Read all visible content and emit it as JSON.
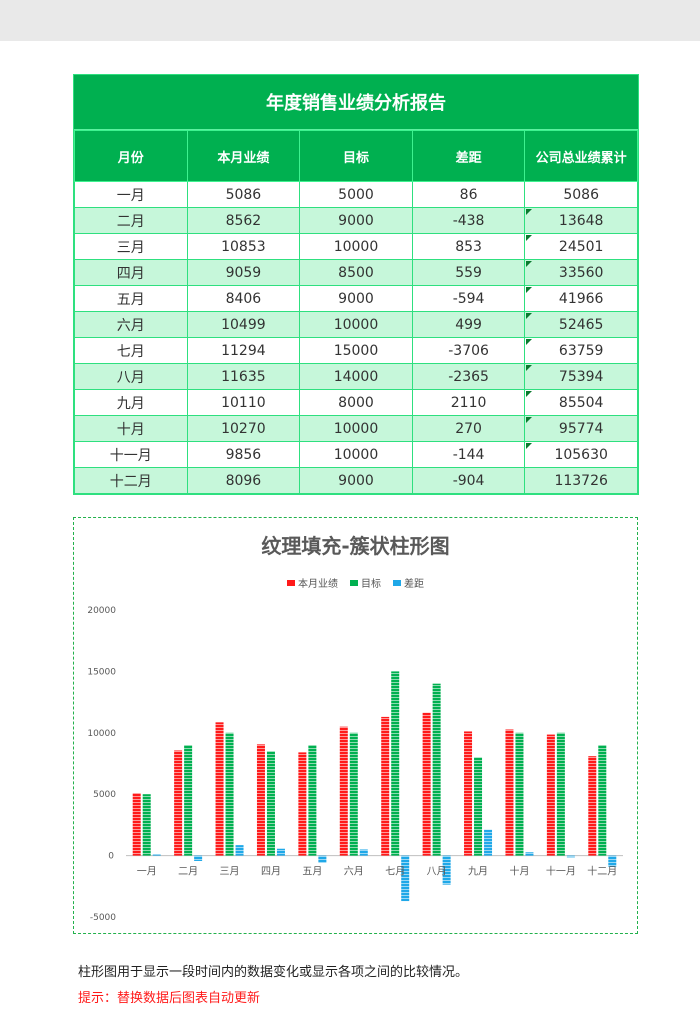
{
  "report": {
    "title": "年度销售业绩分析报告",
    "columns": [
      "月份",
      "本月业绩",
      "目标",
      "差距",
      "公司总业绩累计"
    ],
    "rows": [
      [
        "一月",
        "5086",
        "5000",
        "86",
        "5086"
      ],
      [
        "二月",
        "8562",
        "9000",
        "-438",
        "13648"
      ],
      [
        "三月",
        "10853",
        "10000",
        "853",
        "24501"
      ],
      [
        "四月",
        "9059",
        "8500",
        "559",
        "33560"
      ],
      [
        "五月",
        "8406",
        "9000",
        "-594",
        "41966"
      ],
      [
        "六月",
        "10499",
        "10000",
        "499",
        "52465"
      ],
      [
        "七月",
        "11294",
        "15000",
        "-3706",
        "63759"
      ],
      [
        "八月",
        "11635",
        "14000",
        "-2365",
        "75394"
      ],
      [
        "九月",
        "10110",
        "8000",
        "2110",
        "85504"
      ],
      [
        "十月",
        "10270",
        "10000",
        "270",
        "95774"
      ],
      [
        "十一月",
        "9856",
        "10000",
        "-144",
        "105630"
      ],
      [
        "十二月",
        "8096",
        "9000",
        "-904",
        "113726"
      ]
    ]
  },
  "chart_data": {
    "type": "bar",
    "title": "纹理填充-簇状柱形图",
    "xlabel": "",
    "ylabel": "",
    "categories": [
      "一月",
      "二月",
      "三月",
      "四月",
      "五月",
      "六月",
      "七月",
      "八月",
      "九月",
      "十月",
      "十一月",
      "十二月"
    ],
    "series": [
      {
        "name": "本月业绩",
        "color": "#ff1a1a",
        "values": [
          5086,
          8562,
          10853,
          9059,
          8406,
          10499,
          11294,
          11635,
          10110,
          10270,
          9856,
          8096
        ]
      },
      {
        "name": "目标",
        "color": "#00b050",
        "values": [
          5000,
          9000,
          10000,
          8500,
          9000,
          10000,
          15000,
          14000,
          8000,
          10000,
          10000,
          9000
        ]
      },
      {
        "name": "差距",
        "color": "#1fa8e8",
        "values": [
          86,
          -438,
          853,
          559,
          -594,
          499,
          -3706,
          -2365,
          2110,
          270,
          -144,
          -904
        ]
      }
    ],
    "ylim": [
      -5000,
      20000
    ],
    "yticks": [
      20000,
      15000,
      10000,
      5000,
      0,
      -5000
    ],
    "ytick_labels": [
      "20000",
      "15000",
      "10000",
      "5000",
      "0",
      "-5000"
    ],
    "legend_position": "top-center",
    "grid": false,
    "fill_pattern": "horizontal-stripes"
  },
  "notes": {
    "description": "柱形图用于显示一段时间内的数据变化或显示各项之间的比较情况。",
    "tip": "提示：替换数据后图表自动更新"
  }
}
